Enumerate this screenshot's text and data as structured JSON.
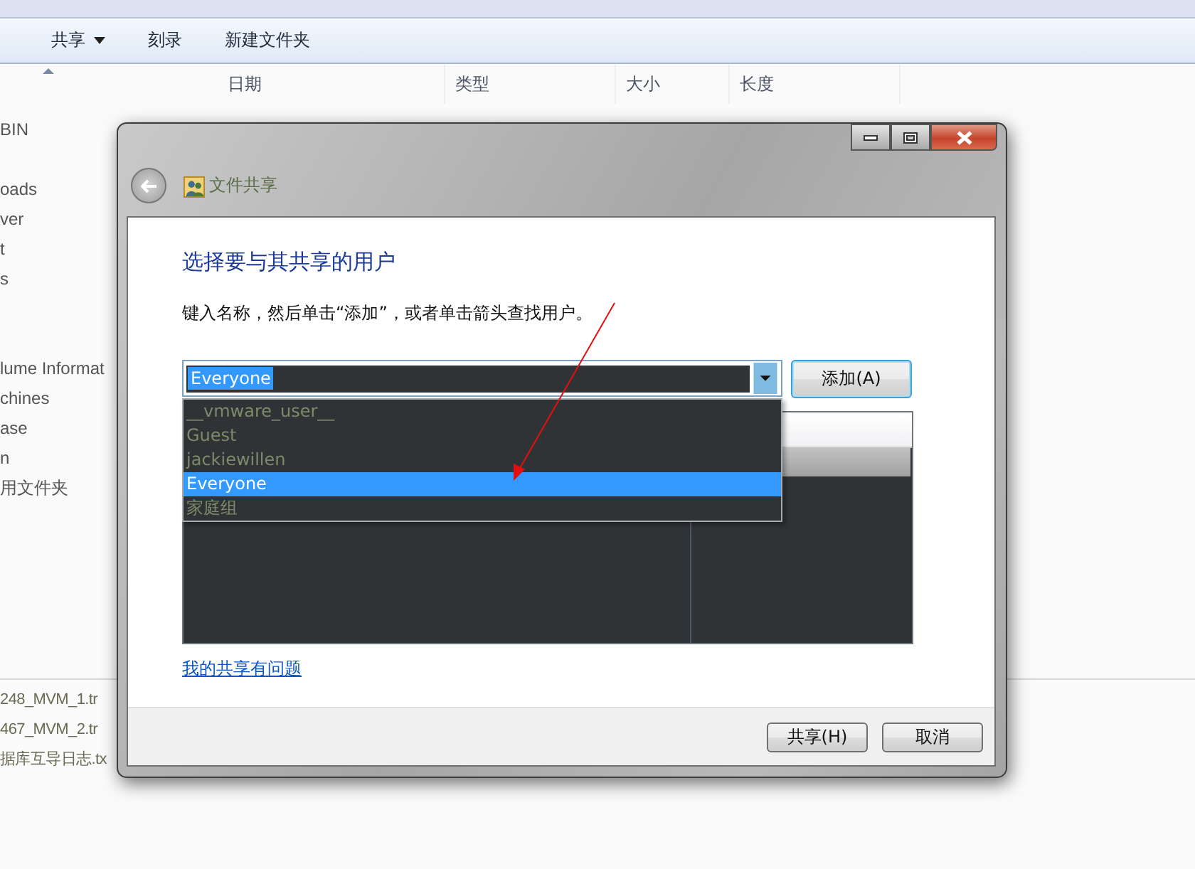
{
  "explorer": {
    "toolbar": [
      {
        "label": "共享",
        "has_menu": true
      },
      {
        "label": "刻录",
        "has_menu": false
      },
      {
        "label": "新建文件夹",
        "has_menu": false
      }
    ],
    "columns": [
      "日期",
      "类型",
      "大小",
      "长度"
    ],
    "nav_groups": [
      [
        "BIN"
      ],
      [
        "oads",
        "ver",
        "t",
        "s"
      ],
      [
        "lume Informat",
        "chines",
        "ase",
        "n",
        "用文件夹"
      ]
    ],
    "files": [
      "248_MVM_1.tr",
      "467_MVM_2.tr",
      "据库互导日志.tx"
    ]
  },
  "dialog": {
    "title": "文件共享",
    "heading": "选择要与其共享的用户",
    "instruction": "键入名称，然后单击“添加”，或者单击箭头查找用户。",
    "combo": {
      "value": "Everyone"
    },
    "add_button": "添加(A)",
    "options": [
      {
        "label": "__vmware_user__",
        "selected": false
      },
      {
        "label": "Guest",
        "selected": false
      },
      {
        "label": "jackiewillen",
        "selected": false
      },
      {
        "label": "Everyone",
        "selected": true
      },
      {
        "label": "家庭组",
        "selected": false
      }
    ],
    "help_link": "我的共享有问题",
    "buttons": [
      "共享(H)",
      "取消"
    ]
  }
}
